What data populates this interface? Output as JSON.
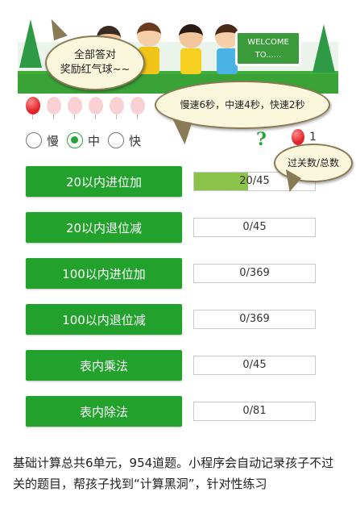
{
  "banner": {
    "sign_text": "WELCOME\nTO......"
  },
  "speed_options": [
    {
      "label": "慢",
      "checked": false
    },
    {
      "label": "中",
      "checked": true
    },
    {
      "label": "快",
      "checked": false
    }
  ],
  "help_icon": "?",
  "balloon_count": "1",
  "units": [
    {
      "label": "20以内进位加",
      "progress": "20/45",
      "fill_fraction": 0.444
    },
    {
      "label": "20以内退位减",
      "progress": "0/45",
      "fill_fraction": 0
    },
    {
      "label": "100以内进位加",
      "progress": "0/369",
      "fill_fraction": 0
    },
    {
      "label": "100以内退位减",
      "progress": "0/369",
      "fill_fraction": 0
    },
    {
      "label": "表内乘法",
      "progress": "0/45",
      "fill_fraction": 0
    },
    {
      "label": "表内除法",
      "progress": "0/81",
      "fill_fraction": 0
    }
  ],
  "bubbles": {
    "reward_line1": "全部答对",
    "reward_line2": "奖励红气球~~",
    "speed": "慢速6秒，中速4秒，快速2秒",
    "progress": "过关数/总数"
  },
  "description": "基础计算总共6单元，954道题。小程序会自动记录孩子不过关的题目，帮孩子找到“计算黑洞”，针对性练习",
  "colors": {
    "button_green": "#22a12d",
    "progress_fill": "#8cc34a",
    "balloon_red": "#e0242b",
    "balloon_pink": "#f9d0d3"
  }
}
